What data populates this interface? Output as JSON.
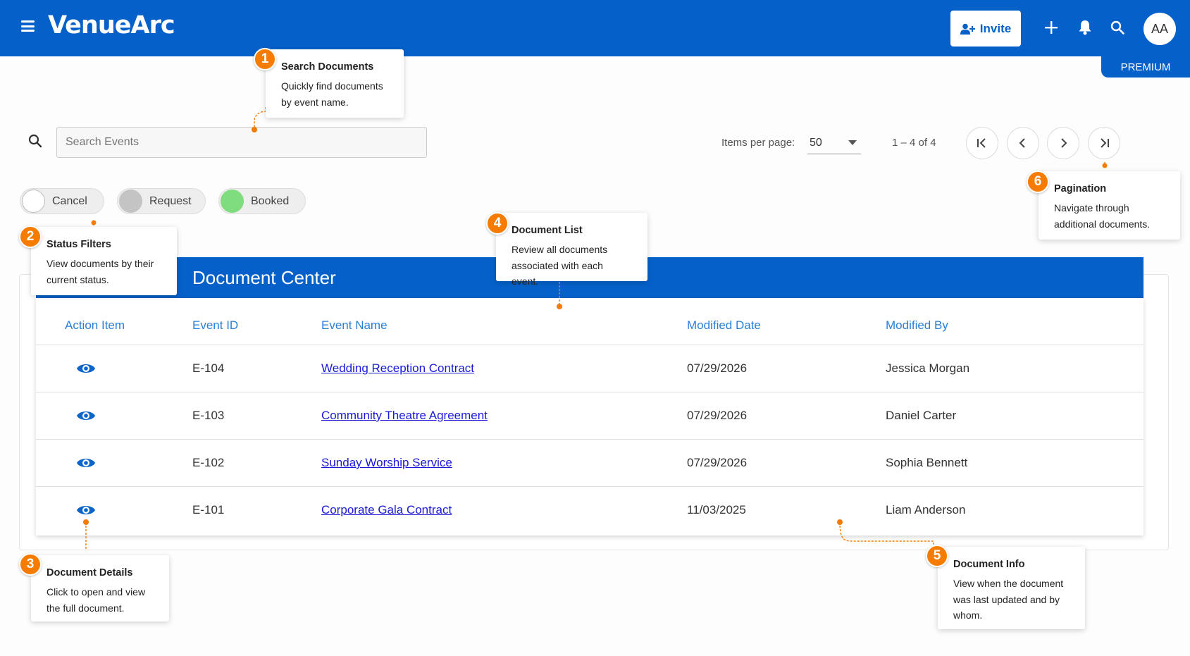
{
  "app": {
    "logo": "VenueArc",
    "plan_badge": "PREMIUM"
  },
  "header": {
    "invite_label": "Invite",
    "avatar_initials": "AA"
  },
  "search": {
    "placeholder": "Search Events",
    "value": ""
  },
  "pagination": {
    "items_label": "Items per page:",
    "per_page": "50",
    "range": "1 – 4 of 4"
  },
  "filters": [
    {
      "label": "Cancel",
      "color": "#ffffff"
    },
    {
      "label": "Request",
      "color": "#c4c4c4"
    },
    {
      "label": "Booked",
      "color": "#7fdc7f"
    }
  ],
  "document_center": {
    "title": "Document Center",
    "columns": [
      "Action Item",
      "Event ID",
      "Event Name",
      "Modified Date",
      "Modified By"
    ],
    "rows": [
      {
        "event_id": "E-104",
        "event_name": "Wedding Reception Contract",
        "modified_date": "07/29/2026",
        "modified_by": "Jessica Morgan"
      },
      {
        "event_id": "E-103",
        "event_name": "Community Theatre Agreement",
        "modified_date": "07/29/2026",
        "modified_by": "Daniel Carter"
      },
      {
        "event_id": "E-102",
        "event_name": "Sunday Worship Service",
        "modified_date": "07/29/2026",
        "modified_by": "Sophia Bennett"
      },
      {
        "event_id": "E-101",
        "event_name": "Corporate Gala Contract",
        "modified_date": "11/03/2025",
        "modified_by": "Liam Anderson"
      }
    ]
  },
  "callouts": [
    {
      "number": "1",
      "title": "Search Documents",
      "lines": [
        "Quickly find documents",
        "by event name."
      ]
    },
    {
      "number": "2",
      "title": "Status Filters",
      "lines": [
        "View documents by their",
        "current status."
      ]
    },
    {
      "number": "3",
      "title": "Document Details",
      "lines": [
        "Click to open and view",
        "the full document."
      ]
    },
    {
      "number": "4",
      "title": "Document List",
      "lines": [
        "Review all documents",
        "associated with each event."
      ]
    },
    {
      "number": "5",
      "title": "Document Info",
      "lines": [
        "View when the document",
        "was last updated and by",
        "whom."
      ]
    },
    {
      "number": "6",
      "title": "Pagination",
      "lines": [
        "Navigate through",
        "additional documents."
      ]
    }
  ],
  "colors": {
    "primary": "#0561c9",
    "accent": "#f57c00",
    "link": "#1a1ad6",
    "header_text": "#2a7fd4"
  },
  "icons": [
    "menu-icon",
    "invite-user-icon",
    "plus-icon",
    "bell-icon",
    "search-icon",
    "first-page-icon",
    "prev-page-icon",
    "next-page-icon",
    "last-page-icon",
    "eye-icon"
  ]
}
